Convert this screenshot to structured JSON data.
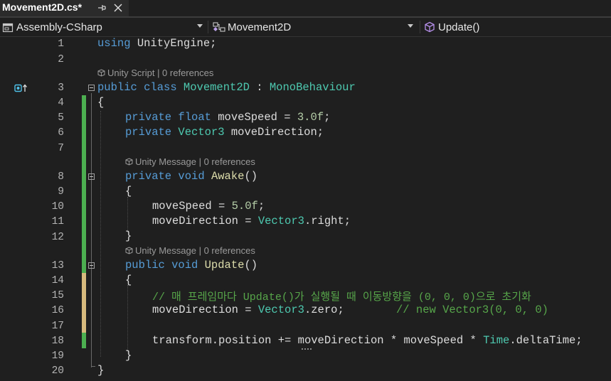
{
  "tab": {
    "title": "Movement2D.cs*"
  },
  "navbar": {
    "project": "Assembly-CSharp",
    "class": "Movement2D",
    "member": "Update()"
  },
  "lens": {
    "class": "Unity Script | 0 references",
    "awake": "Unity Message | 0 references",
    "update": "Unity Message | 0 references"
  },
  "lines": [
    {
      "n": "1"
    },
    {
      "n": "2"
    },
    {
      "n": "3"
    },
    {
      "n": "4"
    },
    {
      "n": "5"
    },
    {
      "n": "6"
    },
    {
      "n": "7"
    },
    {
      "n": "8"
    },
    {
      "n": "9"
    },
    {
      "n": "10"
    },
    {
      "n": "11"
    },
    {
      "n": "12"
    },
    {
      "n": "13"
    },
    {
      "n": "14"
    },
    {
      "n": "15"
    },
    {
      "n": "16"
    },
    {
      "n": "17"
    },
    {
      "n": "18"
    },
    {
      "n": "19"
    },
    {
      "n": "20"
    }
  ],
  "code": {
    "l1_kw": "using",
    "l1_rest": " UnityEngine;",
    "l3_kw1": "public",
    "l3_kw2": " class",
    "l3_name": " Movement2D",
    "l3_colon": " :",
    "l3_base": " MonoBehaviour",
    "l4": "{",
    "l5_kw1": "private",
    "l5_kw2": " float",
    "l5_rest": " moveSpeed = ",
    "l5_num": "3.0f",
    "l5_end": ";",
    "l6_kw": "private",
    "l6_type": " Vector3",
    "l6_rest": " moveDirection;",
    "l8_kw1": "private",
    "l8_kw2": " void",
    "l8_name": " Awake",
    "l8_end": "()",
    "l9": "{",
    "l10_rest": "moveSpeed = ",
    "l10_num": "5.0f",
    "l10_end": ";",
    "l11_rest": "moveDirection = ",
    "l11_type": "Vector3",
    "l11_end": ".right;",
    "l12": "}",
    "l13_kw1": "public",
    "l13_kw2": " void",
    "l13_name": " Update",
    "l13_end": "()",
    "l14": "{",
    "l15_comment": "// 매 프레임마다 Update()가 실행될 때 이동방향을 (0, 0, 0)으로 초기화",
    "l16_rest": "moveDirection = ",
    "l16_type": "Vector3",
    "l16_end": ".zero;",
    "l16_comment": "// new Vector3(0, 0, 0)",
    "l18_a": "transform.position += ",
    "l18_b": "moveDirection * moveSpeed * ",
    "l18_type": "Time",
    "l18_end": ".deltaTime;",
    "l19": "}",
    "l20": "}"
  },
  "colors": {
    "keyword": "#569cd6",
    "type": "#4ec9b0",
    "method": "#dcdcaa",
    "number": "#b5cea8",
    "comment": "#57a64a",
    "changed": "#4caf50",
    "unsaved": "#d7ba7d"
  },
  "icons": {
    "tab_pin": "pin-icon",
    "tab_close": "close-icon",
    "project": "csharp-project-icon",
    "class": "class-icon",
    "member": "method-cube-icon",
    "overrides": "implements-icon"
  }
}
